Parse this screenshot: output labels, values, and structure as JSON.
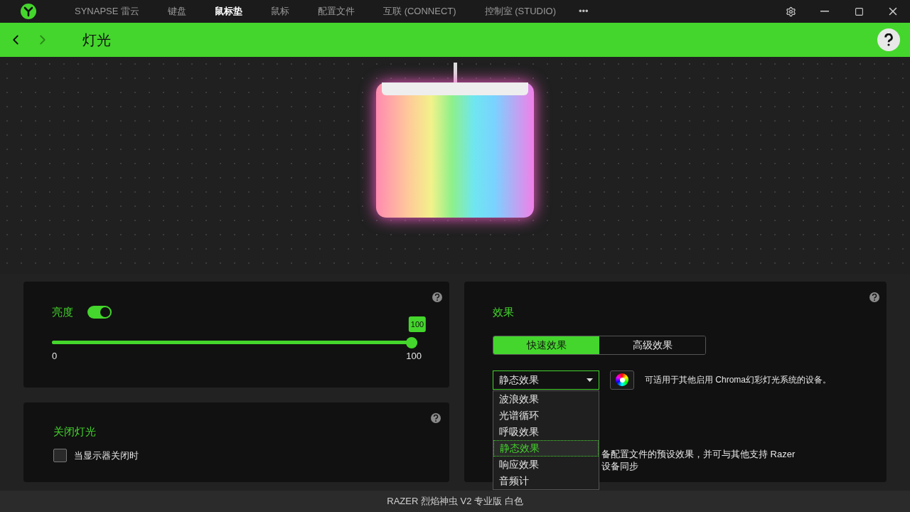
{
  "window": {
    "tabs": [
      {
        "label": "SYNAPSE 雷云",
        "selected": false
      },
      {
        "label": "键盘",
        "selected": false
      },
      {
        "label": "鼠标垫",
        "selected": true
      },
      {
        "label": "鼠标",
        "selected": false
      },
      {
        "label": "配置文件",
        "selected": false
      },
      {
        "label": "互联 (CONNECT)",
        "selected": false
      },
      {
        "label": "控制室 (STUDIO)",
        "selected": false
      }
    ],
    "more": "•••"
  },
  "header": {
    "title": "灯光"
  },
  "brightness": {
    "label": "亮度",
    "on": true,
    "level": 1,
    "value_badge": "100",
    "min": "0",
    "max": "100"
  },
  "lights_off": {
    "title": "关闭灯光",
    "option": {
      "label": "当显示器关闭时",
      "checked": false
    }
  },
  "effects": {
    "title": "效果",
    "tabs": [
      {
        "label": "快速效果",
        "selected": true
      },
      {
        "label": "高级效果",
        "selected": false
      }
    ],
    "dropdown": {
      "value": "静态效果",
      "expanded": true,
      "options": [
        {
          "label": "波浪效果",
          "selected": false
        },
        {
          "label": "光谱循环",
          "selected": false
        },
        {
          "label": "呼吸效果",
          "selected": false
        },
        {
          "label": "静态效果",
          "selected": true
        },
        {
          "label": "响应效果",
          "selected": false
        },
        {
          "label": "音频计",
          "selected": false
        }
      ]
    },
    "chroma_note": "可适用于其他启用 Chroma幻彩灯光系统的设备。",
    "sync_note": "备配置文件的预设效果，并可与其他支持 Razer 设备同步"
  },
  "status_bar": "RAZER 烈焰神虫 V2 专业版 白色"
}
